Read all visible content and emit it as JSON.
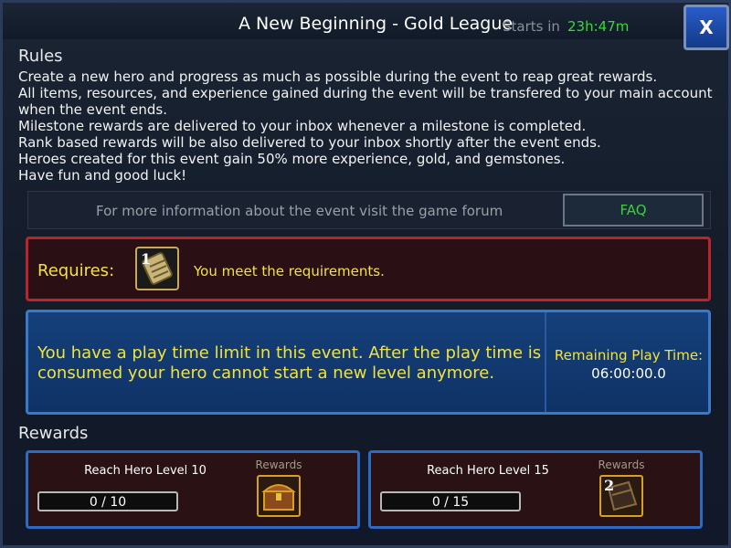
{
  "header": {
    "title": "A New Beginning - Gold League",
    "starts_label": "Starts in",
    "timer": "23h:47m",
    "close_label": "X"
  },
  "rules": {
    "heading": "Rules",
    "lines": [
      "Create a new hero and progress as much as possible during the event to reap great rewards.",
      "All items, resources, and experience gained during the event will be transfered to your main account",
      "when the event ends.",
      "Milestone rewards are delivered to your inbox whenever a milestone is completed.",
      "Rank based rewards will be also delivered to your inbox shortly after the event ends.",
      "Heroes created for this event gain 50% more experience, gold, and gemstones.",
      "Have fun and good luck!"
    ]
  },
  "info_bar": {
    "text": "For more information about the event visit the game forum",
    "faq_label": "FAQ"
  },
  "requires": {
    "label": "Requires:",
    "icon_number": "1",
    "message": "You meet the requirements."
  },
  "play_time": {
    "message": "You have a play time limit in this event. After the play time is consumed your hero cannot start a new level anymore.",
    "label": "Remaining Play Time:",
    "value": "06:00:00.0"
  },
  "rewards": {
    "heading": "Rewards",
    "items": [
      {
        "title": "Reach Hero Level 10",
        "progress": "0 / 10",
        "rewards_label": "Rewards",
        "icon_number": ""
      },
      {
        "title": "Reach Hero Level 15",
        "progress": "0 / 15",
        "rewards_label": "Rewards",
        "icon_number": "2"
      }
    ]
  },
  "colors": {
    "accent_yellow": "#f2e23a",
    "timer_green": "#33dd33",
    "faq_green": "#3ccf3c",
    "requires_border": "#b8262c",
    "playtime_bg": "#15407a",
    "reward_border": "#2e6ac4"
  }
}
